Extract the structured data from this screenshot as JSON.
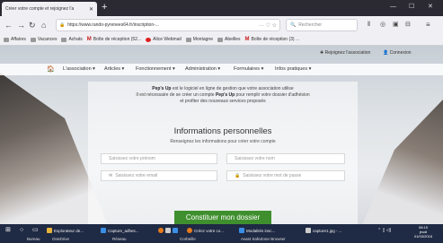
{
  "browser": {
    "tab_title": "Créer votre compte et rejoignez l'a",
    "url": "https://www.rando-pyrenees64.fr/inscription-...",
    "search_placeholder": "Rechercher",
    "bookmarks": [
      {
        "label": "Affaires",
        "icon": "folder-icon"
      },
      {
        "label": "Vacances",
        "icon": "folder-icon"
      },
      {
        "label": "Achats",
        "icon": "folder-icon"
      },
      {
        "label": "Boîte de réception (52...",
        "icon": "gmail-icon"
      },
      {
        "label": "Alice Webmail",
        "icon": "alice-icon"
      },
      {
        "label": "Montagne",
        "icon": "folder-icon"
      },
      {
        "label": "Abeilles",
        "icon": "folder-icon"
      },
      {
        "label": "Boîte de réception (3) ...",
        "icon": "gmail-icon"
      }
    ]
  },
  "site": {
    "top_links": {
      "rejoignez": "Rejoignez l'association",
      "connexion": "Connexion"
    },
    "nav": [
      "L'association",
      "Articles",
      "Fonctionnement",
      "Administration",
      "Formulaires",
      "Infos pratiques"
    ],
    "intro": {
      "brand": "Pep's Up",
      "line1": " est le logiciel en ligne de gestion que votre association utilise",
      "line2a": "Il est nécessaire de se créer un compte ",
      "line2b": " pour remplir votre dossier d'adhésion",
      "line3": "et profiter des nouveaux services proposés"
    },
    "form": {
      "title": "Informations personnelles",
      "subtitle": "Renseignez les informations pour créer votre compte",
      "firstname_placeholder": "Saisissez votre prénom",
      "lastname_placeholder": "Saisissez votre nom",
      "email_placeholder": "Saisissez votre email",
      "password_placeholder": "Saisissez votre mot de passe",
      "submit": "Constituer mon dossier"
    }
  },
  "taskbar": {
    "apps": [
      "Explorateur de...",
      "Capture_adhes...",
      "Créez votre co...",
      "Modalités insc...",
      "capture1.jpg - ..."
    ],
    "status": [
      "Bureau",
      "OneDrive",
      "Réseau",
      "Corbeille",
      "Avast SafeZone Browser"
    ],
    "clock": {
      "time": "08:15",
      "day": "jeudi",
      "date": "01/03/2018"
    }
  },
  "colors": {
    "submit": "#3f8f2e",
    "taskbar": "#1f2a44"
  }
}
